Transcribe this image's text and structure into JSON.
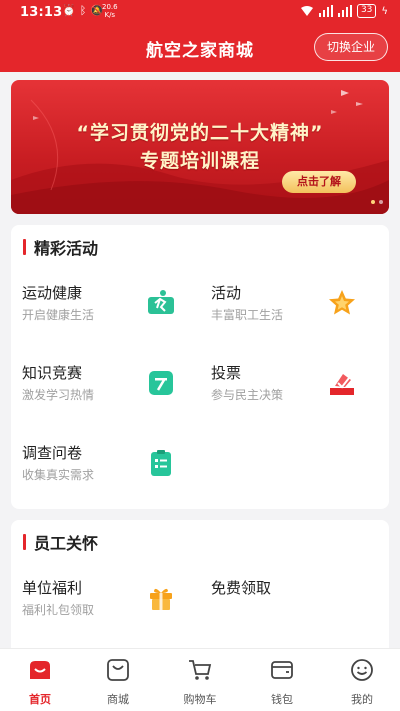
{
  "status_bar": {
    "time": "13:13",
    "speed_value": "20.6",
    "speed_unit": "K/s",
    "battery": "33"
  },
  "header": {
    "title": "航空之家商城",
    "switch_label": "切换企业"
  },
  "banner": {
    "line1": "“学习贯彻党的二十大精神”",
    "line2": "专题培训课程",
    "cta": "点击了解"
  },
  "activities": {
    "title": "精彩活动",
    "items": [
      {
        "name": "运动健康",
        "desc": "开启健康生活",
        "icon": "run-icon"
      },
      {
        "name": "活动",
        "desc": "丰富职工生活",
        "icon": "star-icon"
      },
      {
        "name": "知识竞赛",
        "desc": "激发学习热情",
        "icon": "quiz-icon"
      },
      {
        "name": "投票",
        "desc": "参与民主决策",
        "icon": "vote-icon"
      },
      {
        "name": "调查问卷",
        "desc": "收集真实需求",
        "icon": "survey-icon"
      }
    ]
  },
  "care": {
    "title": "员工关怀",
    "items": [
      {
        "name": "单位福利",
        "desc": "福利礼包领取",
        "icon": "gift-icon"
      },
      {
        "name": "免费领取",
        "desc": ""
      }
    ]
  },
  "tabs": [
    {
      "label": "首页",
      "icon": "home-icon",
      "active": true
    },
    {
      "label": "商城",
      "icon": "shop-icon",
      "active": false
    },
    {
      "label": "购物车",
      "icon": "cart-icon",
      "active": false
    },
    {
      "label": "钱包",
      "icon": "wallet-icon",
      "active": false
    },
    {
      "label": "我的",
      "icon": "profile-icon",
      "active": false
    }
  ],
  "colors": {
    "brand": "#e4262b",
    "background": "#f3f3f5"
  }
}
